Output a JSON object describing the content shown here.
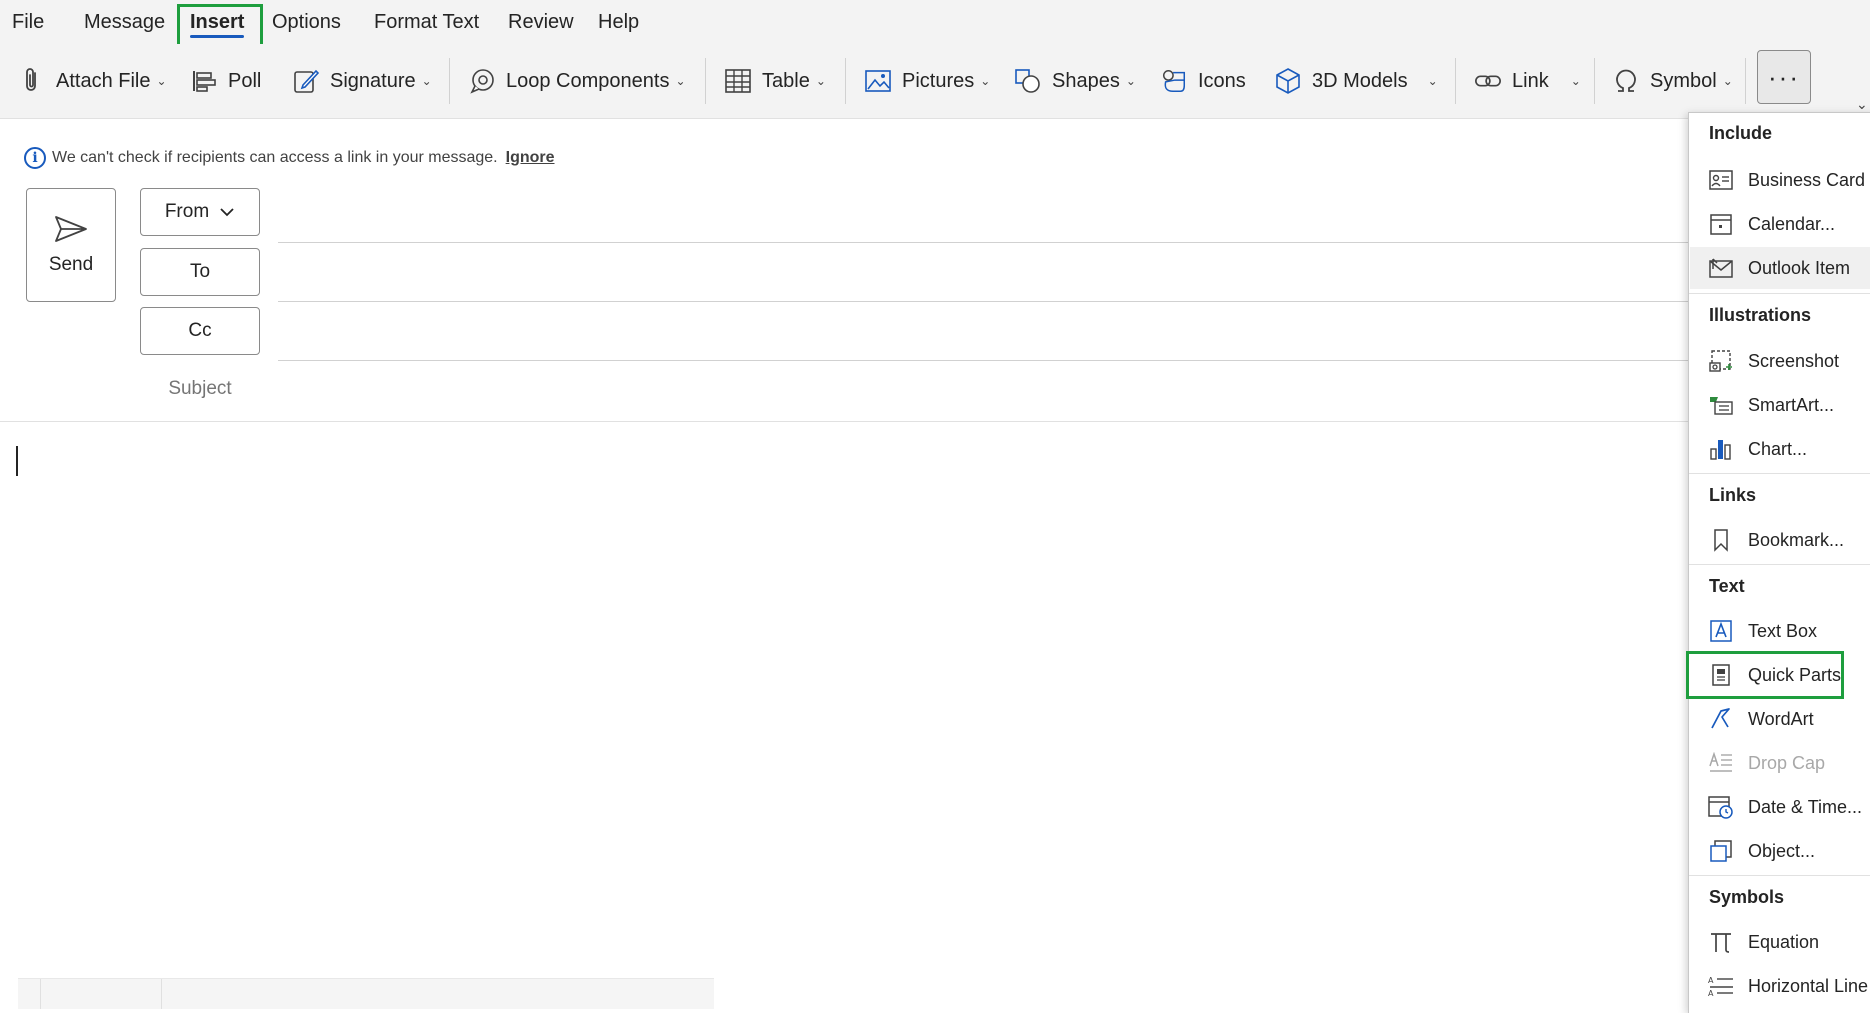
{
  "menubar": {
    "items": [
      {
        "label": "File"
      },
      {
        "label": "Message"
      },
      {
        "label": "Insert"
      },
      {
        "label": "Options"
      },
      {
        "label": "Format Text"
      },
      {
        "label": "Review"
      },
      {
        "label": "Help"
      }
    ],
    "active": "Insert"
  },
  "ribbon": {
    "attach_file": "Attach File",
    "poll": "Poll",
    "signature": "Signature",
    "loop_components": "Loop Components",
    "table": "Table",
    "pictures": "Pictures",
    "shapes": "Shapes",
    "icons": "Icons",
    "models_3d": "3D Models",
    "link": "Link",
    "symbol": "Symbol",
    "more": "···"
  },
  "infobar": {
    "message": "We can't check if recipients can access a link in your message.",
    "ignore": "Ignore"
  },
  "compose": {
    "send": "Send",
    "from": "From",
    "to": "To",
    "cc": "Cc",
    "subject": "Subject"
  },
  "dropdown": {
    "sections": [
      {
        "heading": "Include",
        "items": [
          "Business Card",
          "Calendar...",
          "Outlook Item"
        ]
      },
      {
        "heading": "Illustrations",
        "items": [
          "Screenshot",
          "SmartArt...",
          "Chart..."
        ]
      },
      {
        "heading": "Links",
        "items": [
          "Bookmark..."
        ]
      },
      {
        "heading": "Text",
        "items": [
          "Text Box",
          "Quick Parts",
          "WordArt",
          "Drop Cap",
          "Date & Time...",
          "Object..."
        ]
      },
      {
        "heading": "Symbols",
        "items": [
          "Equation",
          "Horizontal Line"
        ]
      }
    ],
    "hovered": "Outlook Item",
    "disabled": "Drop Cap",
    "highlighted": "Quick Parts"
  },
  "colors": {
    "accent": "#185abd",
    "highlight_box": "#1e9e3e",
    "smartart_green": "#2e8b3d"
  }
}
